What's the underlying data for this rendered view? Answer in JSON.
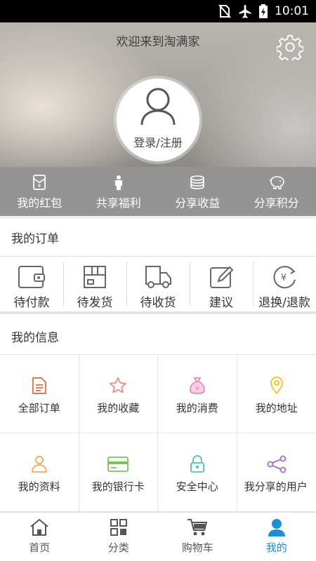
{
  "status_bar": {
    "time": "10:01"
  },
  "header": {
    "welcome": "欢迎来到淘满家",
    "login_label": "登录/注册"
  },
  "quick_links": [
    {
      "label": "我的红包",
      "icon": "red-envelope-icon"
    },
    {
      "label": "共享福利",
      "icon": "person-icon"
    },
    {
      "label": "分享收益",
      "icon": "coins-icon"
    },
    {
      "label": "分享积分",
      "icon": "piggy-bank-icon"
    }
  ],
  "orders": {
    "title": "我的订单",
    "items": [
      {
        "label": "待付款",
        "icon": "wallet-icon"
      },
      {
        "label": "待发货",
        "icon": "box-icon"
      },
      {
        "label": "待收货",
        "icon": "truck-icon"
      },
      {
        "label": "建议",
        "icon": "edit-icon"
      },
      {
        "label": "退换/退款",
        "icon": "refund-icon"
      }
    ]
  },
  "info": {
    "title": "我的信息",
    "items": [
      {
        "label": "全部订单",
        "icon": "document-icon",
        "color": "#e8794a"
      },
      {
        "label": "我的收藏",
        "icon": "star-icon",
        "color": "#ee8a80"
      },
      {
        "label": "我的消费",
        "icon": "money-bag-icon",
        "color": "#e58ab8"
      },
      {
        "label": "我的地址",
        "icon": "location-pin-icon",
        "color": "#f0c419"
      },
      {
        "label": "我的资料",
        "icon": "user-icon",
        "color": "#f2a65a"
      },
      {
        "label": "我的银行卡",
        "icon": "bank-card-icon",
        "color": "#7cc35b"
      },
      {
        "label": "安全中心",
        "icon": "lock-icon",
        "color": "#4cc6a6"
      },
      {
        "label": "我分享的用户",
        "icon": "share-icon",
        "color": "#a56bd1"
      }
    ]
  },
  "tabbar": [
    {
      "label": "首页",
      "icon": "home-icon",
      "active": false
    },
    {
      "label": "分类",
      "icon": "category-icon",
      "active": false
    },
    {
      "label": "购物车",
      "icon": "cart-icon",
      "active": false
    },
    {
      "label": "我的",
      "icon": "profile-icon",
      "active": true
    }
  ],
  "colors": {
    "accent": "#1d8fd8",
    "divider": "#e3e3e3"
  }
}
